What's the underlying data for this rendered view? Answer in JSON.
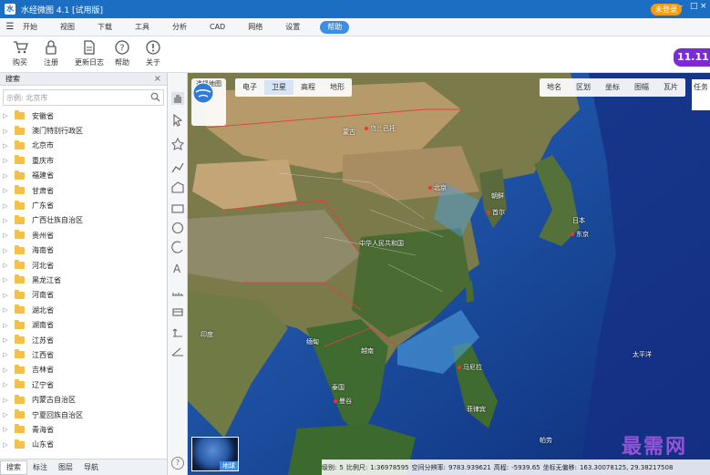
{
  "titlebar": {
    "title": "水经微图 4.1 [试用版]",
    "login": "未登录"
  },
  "menu": [
    "开始",
    "视图",
    "下载",
    "工具",
    "分析",
    "CAD",
    "网络",
    "设置",
    "帮助"
  ],
  "toolbar": [
    {
      "label": "购买",
      "icon": "cart-icon"
    },
    {
      "label": "注册",
      "icon": "lock-icon"
    },
    {
      "label": "更新日志",
      "icon": "document-icon"
    },
    {
      "label": "帮助",
      "icon": "question-icon"
    },
    {
      "label": "关于",
      "icon": "info-icon"
    }
  ],
  "promo": "11.11",
  "left_panel": {
    "title": "搜索",
    "close": "×",
    "search_placeholder": "示例: 北京市",
    "items": [
      "安徽省",
      "澳门特别行政区",
      "北京市",
      "重庆市",
      "福建省",
      "甘肃省",
      "广东省",
      "广西壮族自治区",
      "贵州省",
      "海南省",
      "河北省",
      "黑龙江省",
      "河南省",
      "湖北省",
      "湖南省",
      "江苏省",
      "江西省",
      "吉林省",
      "辽宁省",
      "内蒙古自治区",
      "宁夏回族自治区",
      "青海省",
      "山东省"
    ],
    "tabs": [
      "搜索",
      "标注",
      "图层",
      "导航"
    ]
  },
  "map": {
    "selector_label": "选择地图",
    "left_buttons": [
      "电子",
      "卫星",
      "高程",
      "地形"
    ],
    "right_buttons": [
      "地名",
      "区划",
      "坐标",
      "图幅",
      "瓦片"
    ],
    "task_label": "任务",
    "labels": [
      "蒙古",
      "乌兰巴托",
      "北京",
      "朝鲜",
      "首尔",
      "日本",
      "东京",
      "中华人民共和国",
      "缅甸",
      "泰国",
      "曼谷",
      "菲律宾",
      "马尼拉",
      "越南",
      "印度",
      "太平洋",
      "帕劳"
    ],
    "globe_label": "地球",
    "status": {
      "level_label": "级别:",
      "level": "5",
      "scale_label": "比例尺:",
      "scale": "1:36978595",
      "spatial_label": "空间分辨率:",
      "spatial": "9783.939621",
      "elev_label": "高程:",
      "elev": "-5939.65",
      "coord_label": "坐标无偏移:",
      "coord": "163.30078125, 29.38217508"
    },
    "watermark": "最需网"
  },
  "colors": {
    "titlebar": "#1b6ec2",
    "accent": "#3a8ee6",
    "login": "#f39c12",
    "promo": "#7b2bd6"
  }
}
